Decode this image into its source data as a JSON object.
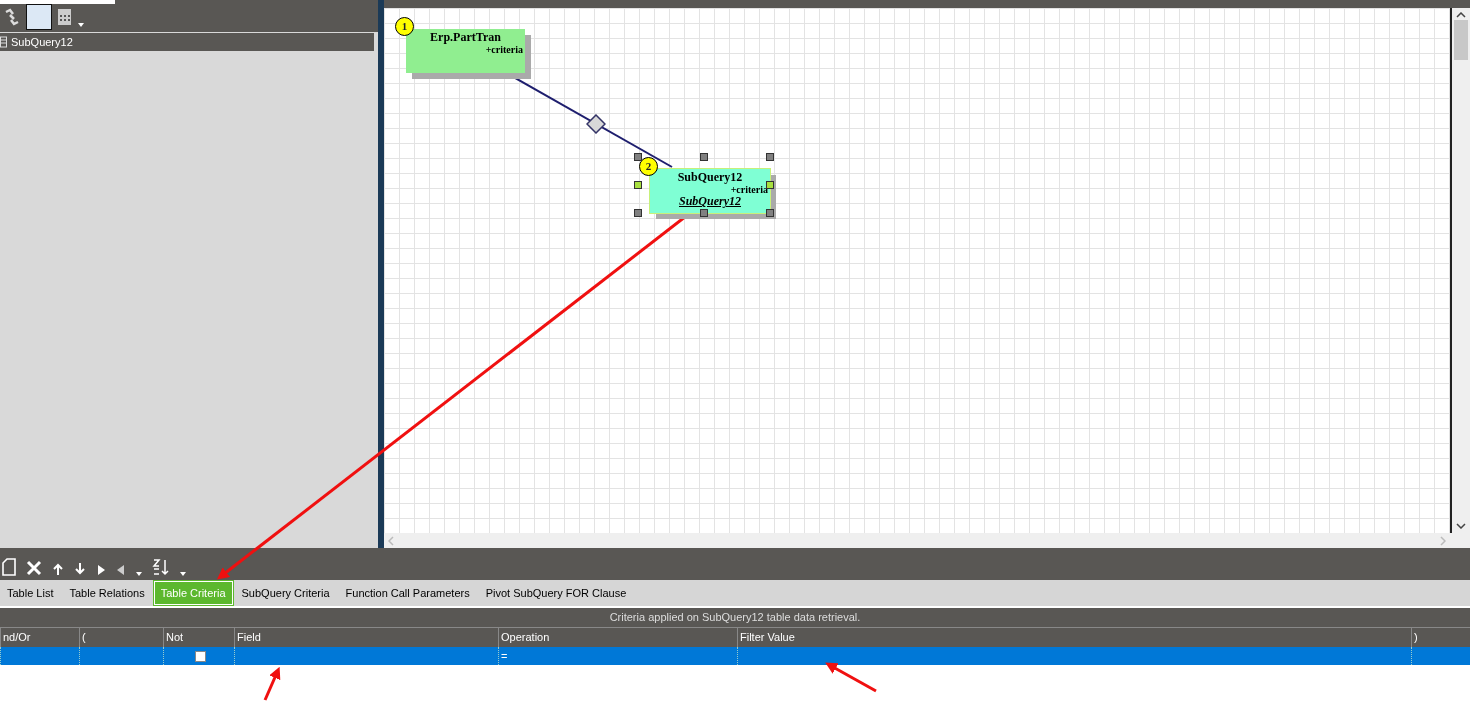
{
  "tree": {
    "items": [
      {
        "label": "SubQuery12"
      }
    ]
  },
  "diagram": {
    "nodes": [
      {
        "number": "1",
        "title": "Erp.PartTran",
        "criteria": "+criteria",
        "selected": false,
        "color": "#90ee90"
      },
      {
        "number": "2",
        "title": "SubQuery12",
        "criteria": "+criteria",
        "alias": "SubQuery12",
        "selected": true,
        "color": "#7fffd4"
      }
    ]
  },
  "tabs": [
    {
      "label": "Table List",
      "selected": false
    },
    {
      "label": "Table Relations",
      "selected": false
    },
    {
      "label": "Table Criteria",
      "selected": true
    },
    {
      "label": "SubQuery Criteria",
      "selected": false
    },
    {
      "label": "Function Call Parameters",
      "selected": false
    },
    {
      "label": "Pivot SubQuery FOR Clause",
      "selected": false
    }
  ],
  "criteria_caption": "Criteria applied on SubQuery12 table data retrieval.",
  "table": {
    "columns": [
      "nd/Or",
      "(",
      "Not",
      "Field",
      "Operation",
      "Filter Value",
      ")"
    ],
    "rows": [
      {
        "selected": true,
        "not": false,
        "operation": "="
      }
    ]
  }
}
